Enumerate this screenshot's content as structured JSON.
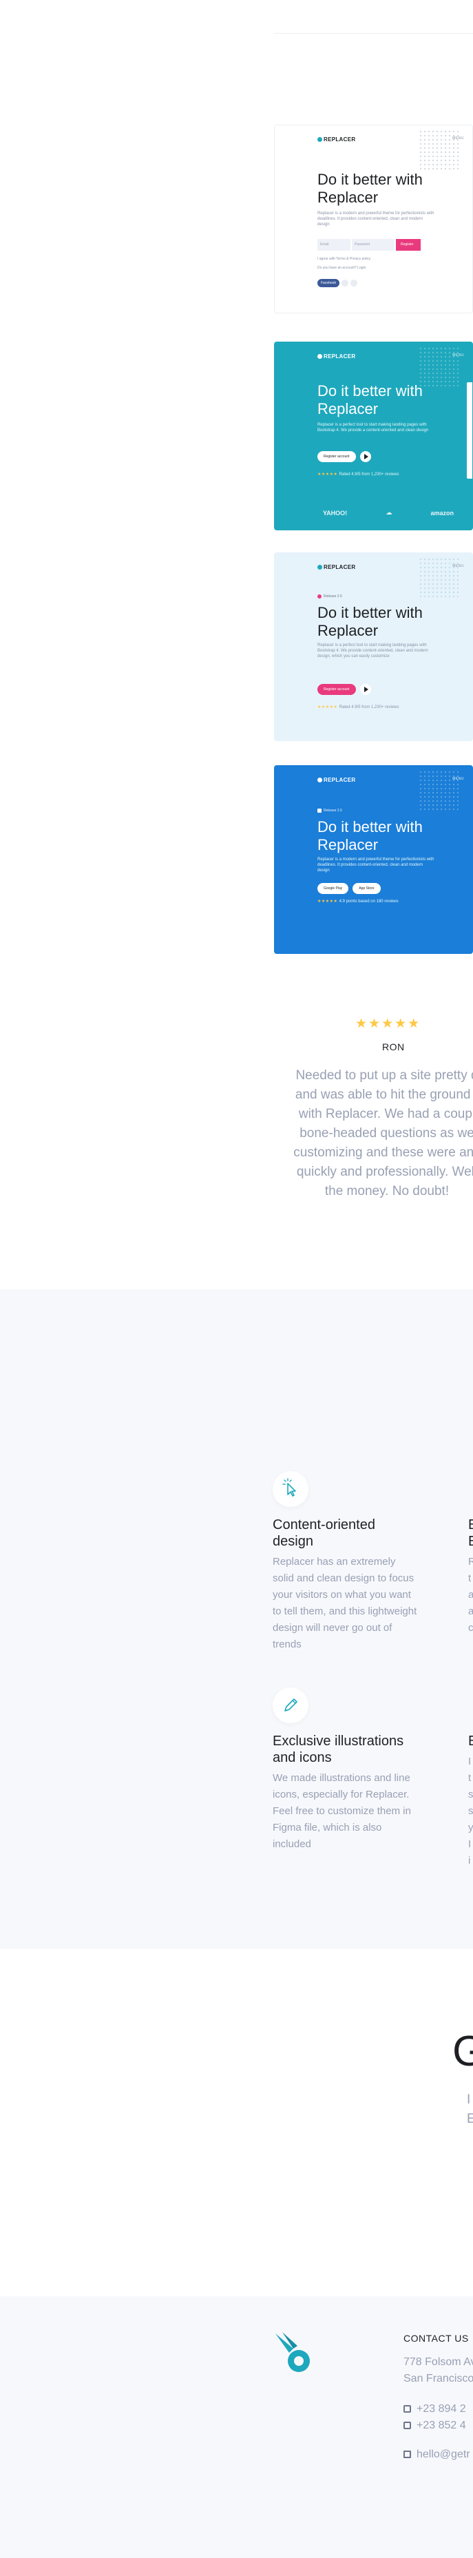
{
  "showcase": [
    {
      "logo": "REPLACER",
      "menu": "MENU",
      "heading": "Do it better with Replacer",
      "text": "Replacer is a modern and powerful theme for perfectionists with deadlines. It provides content-oriented, clean and modern design",
      "email_placeholder": "Email",
      "password_placeholder": "Password",
      "submit": "Register",
      "agree": "I agree with Terms & Privacy policy",
      "login": "Do you have an account? Login",
      "facebook": "Facebook"
    },
    {
      "logo": "REPLACER",
      "menu": "MENU",
      "heading": "Do it better with Replacer",
      "text": "Replacer is a perfect tool to start making landing pages with Bootstrap 4. We provide a content-oriented and clean design",
      "button": "Register account",
      "rating_note": "Rated 4.9/5 from 1,230+ reviews",
      "brands": [
        "YAHOO!",
        "☁",
        "amazon"
      ]
    },
    {
      "logo": "REPLACER",
      "menu": "MENU",
      "badge": "Release 2.0",
      "heading": "Do it better with Replacer",
      "text": "Replacer is a perfect tool to start making landing pages with Bootstrap 4. We provide content-oriented, clean and modern design, which you can easily customize",
      "button": "Register account",
      "rating_note": "Rated 4.9/5 from 1,230+ reviews"
    },
    {
      "logo": "REPLACER",
      "menu": "MENU",
      "badge": "Release 2.0",
      "heading": "Do it better with Replacer",
      "text": "Replacer is a modern and powerful theme for perfectionists with deadlines. It provides content-oriented, clean and modern design",
      "google_play": "Google Play",
      "app_store": "App Store",
      "rating_note": "4.9 points based on 180 reviews"
    }
  ],
  "testimonial": {
    "stars": "★★★★★",
    "name": "RON",
    "lines": [
      "Needed to put up a site pretty q",
      "and was able to hit the ground r",
      "with Replacer. We had a coupl",
      "bone-headed questions as we",
      "customizing and these were ans",
      "quickly and professionally. Well",
      "the money. No doubt!"
    ]
  },
  "features": [
    {
      "icon": "cursor-click-icon",
      "title": "Content-oriented design",
      "text": "Replacer has an extremely solid and clean design to focus your visitors on what you want to tell them, and this lightweight design will never go out of trends"
    },
    {
      "icon": "pencil-icon",
      "title": "Exclusive illustrations and icons",
      "text": "We made illustrations and line icons, especially for Replacer. Feel free to customize them in Figma file, which is also included"
    }
  ],
  "features_edge": {
    "col2_title_lines": [
      "E",
      "E"
    ],
    "col2_text_lines": [
      "R",
      "t",
      "a",
      "a",
      "c"
    ],
    "col2b_title_lines": [
      "E"
    ],
    "col2b_text_lines": [
      "I",
      "t",
      "s",
      "s",
      "y",
      "I",
      "i"
    ]
  },
  "cta": {
    "heading_fragment": "G",
    "sub_lines": [
      "I",
      "E"
    ]
  },
  "footer": {
    "contact_title": "CONTACT US",
    "address_lines": [
      "778 Folsom Av",
      "San Francisco"
    ],
    "phones": [
      "+23 894 2",
      "+23 852 4"
    ],
    "email": "hello@getr"
  }
}
